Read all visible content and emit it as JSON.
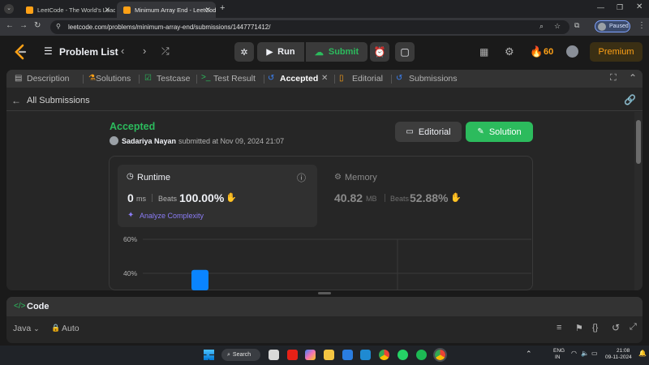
{
  "browser": {
    "tabs": [
      {
        "title": "LeetCode - The World's Leadin",
        "active": false
      },
      {
        "title": "Minimum Array End - LeetCode",
        "active": true
      }
    ],
    "new_tab": "+",
    "url": "leetcode.com/problems/minimum-array-end/submissions/1447771412/",
    "profile_status": "Paused"
  },
  "nav": {
    "problem_list": "Problem List",
    "run": "Run",
    "submit": "Submit",
    "streak": "60",
    "premium": "Premium"
  },
  "panel_tabs": [
    "Description",
    "Solutions",
    "Testcase",
    "Test Result",
    "Accepted",
    "Editorial",
    "Submissions"
  ],
  "submission": {
    "back": "All Submissions",
    "status": "Accepted",
    "user": "Sadariya Nayan",
    "submitted_text": "submitted at Nov 09, 2024 21:07",
    "editorial_btn": "Editorial",
    "solution_btn": "Solution"
  },
  "runtime": {
    "label": "Runtime",
    "value": "0",
    "unit": "ms",
    "beats_label": "Beats",
    "beats": "100.00%",
    "analyze": "Analyze Complexity"
  },
  "memory": {
    "label": "Memory",
    "value": "40.82",
    "unit": "MB",
    "beats_label": "Beats",
    "beats": "52.88%"
  },
  "chart_data": {
    "type": "bar",
    "ytick_labels": [
      "60%",
      "40%"
    ],
    "ylim": [
      0,
      60
    ],
    "bars": [
      {
        "value": 42,
        "color": "#0a84ff"
      }
    ]
  },
  "code": {
    "title": "Code",
    "language": "Java",
    "mode": "Auto"
  },
  "taskbar": {
    "search": "Search",
    "lang_top": "ENG",
    "lang_bottom": "IN",
    "time": "21:08",
    "date": "09-11-2024"
  },
  "colors": {
    "accent_green": "#2cbb5d",
    "brand_orange": "#ffa116",
    "bar_blue": "#0a84ff",
    "analyze_purple": "#8b7cf6"
  }
}
